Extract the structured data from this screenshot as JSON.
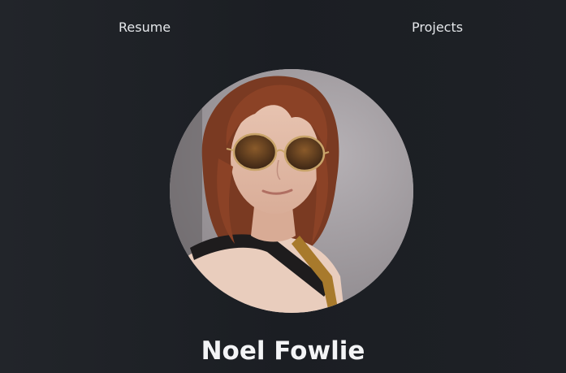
{
  "nav": {
    "links": [
      {
        "label": "Resume"
      },
      {
        "label": "Projects"
      }
    ]
  },
  "profile": {
    "name": "Noel Fowlie",
    "photo_icon": "profile-photo"
  },
  "colors": {
    "background": "#1c1f24",
    "text": "#e9ecef",
    "heading": "#f3f4f6"
  }
}
